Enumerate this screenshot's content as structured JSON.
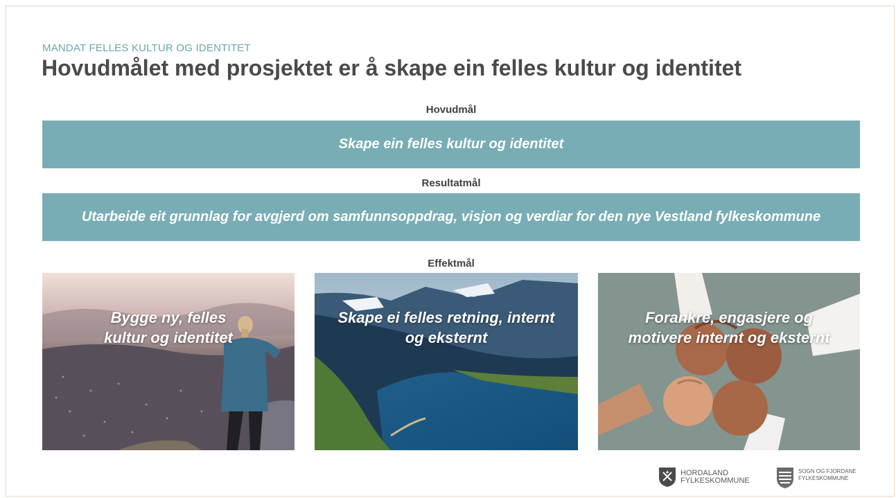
{
  "header": {
    "kicker": "MANDAT FELLES KULTUR OG IDENTITET",
    "title": "Hovudmålet med prosjektet er å skape ein felles kultur og identitet"
  },
  "main_goal": {
    "label": "Hovudmål",
    "text": "Skape ein felles kultur og identitet"
  },
  "result_goal": {
    "label": "Resultatmål",
    "text": "Utarbeide eit grunnlag for avgjerd om samfunnsoppdrag, visjon og verdiar for den nye Vestland fylkeskommune"
  },
  "effect_goals": {
    "label": "Effektmål",
    "cards": [
      {
        "line1": "Bygge ny, felles",
        "line2": "kultur og identitet"
      },
      {
        "line1": "Skape ei felles retning, internt",
        "line2": "og eksternt"
      },
      {
        "line1": "Forankre, engasjere og",
        "line2": "motivere internt og eksternt"
      }
    ]
  },
  "logos": {
    "hordaland": {
      "line1": "HORDALAND",
      "line2": "FYLKESKOMMUNE"
    },
    "sogn": {
      "line1": "SOGN OG FJORDANE",
      "line2": "FYLKESKOMMUNE"
    }
  },
  "colors": {
    "accent_bar": "#79adb5",
    "kicker": "#6aa6ae",
    "title": "#4a4a4a"
  }
}
